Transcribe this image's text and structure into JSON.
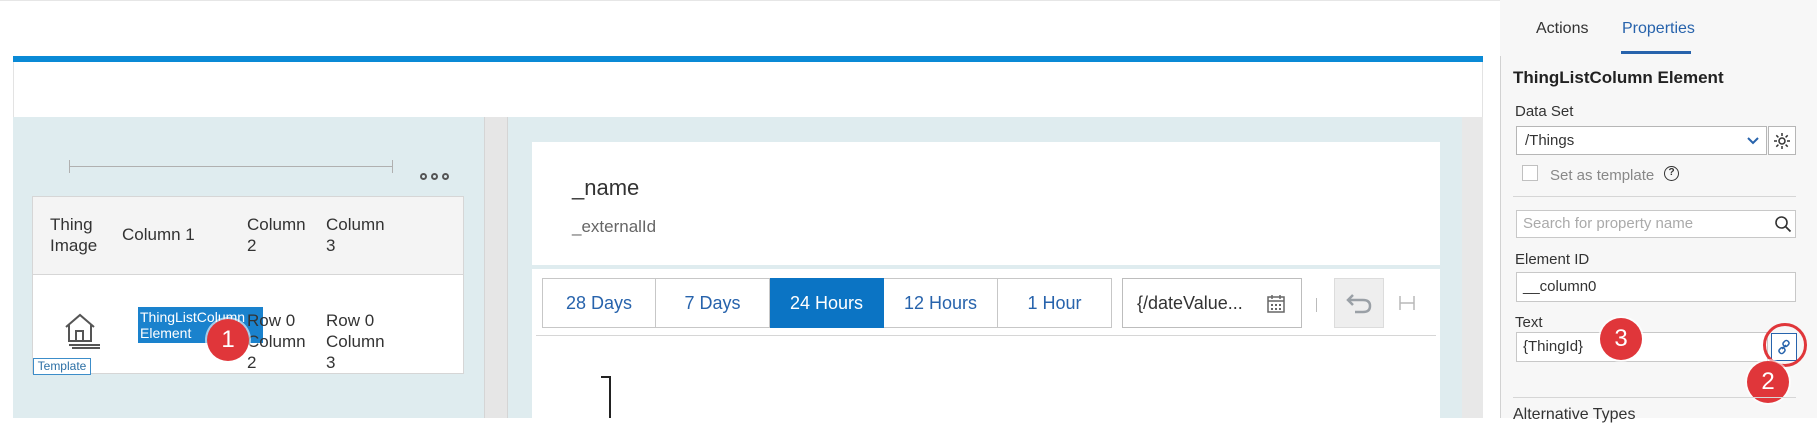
{
  "canvas": {
    "table": {
      "headers": [
        "Thing\nImage",
        "Column 1",
        "Column\n2",
        "Column\n3"
      ],
      "row0": {
        "col1": "ThingListColumn Element",
        "col2": "Row 0\nColumn\n2",
        "col3": "Row 0\nColumn\n3"
      },
      "template_badge": "Template"
    },
    "object_header": {
      "title": "_name",
      "subtitle": "_externalId"
    },
    "time_range": {
      "options": [
        "28 Days",
        "7 Days",
        "24 Hours",
        "12 Hours",
        "1 Hour"
      ],
      "selected": "24 Hours",
      "date_value": "{/dateValue..."
    }
  },
  "annotations": {
    "badge1": "1",
    "badge2": "2",
    "badge3": "3"
  },
  "props": {
    "tabs": {
      "actions": "Actions",
      "properties": "Properties"
    },
    "active_tab": "Properties",
    "title": "ThingListColumn Element",
    "data_set_label": "Data Set",
    "data_set_value": "/Things",
    "set_as_template_label": "Set as template",
    "search_placeholder": "Search for property name",
    "element_id_label": "Element ID",
    "element_id_value": "__column0",
    "text_label": "Text",
    "text_value": "{ThingId}",
    "alternative_types_label": "Alternative Types"
  },
  "icons": {
    "thing_image": "house-image-icon",
    "more": "more-horizontal-icon",
    "calendar": "calendar-icon",
    "undo": "undo-icon",
    "h": "h-icon",
    "dropdown": "chevron-down-icon",
    "gear": "gear-icon",
    "help": "help-circle-icon",
    "search": "search-icon",
    "bind": "link-icon"
  },
  "colors": {
    "accent": "#0a8ad6",
    "selected_segment": "#0b74c4",
    "highlight": "#1a82cd",
    "annotation_red": "#e0363a"
  }
}
